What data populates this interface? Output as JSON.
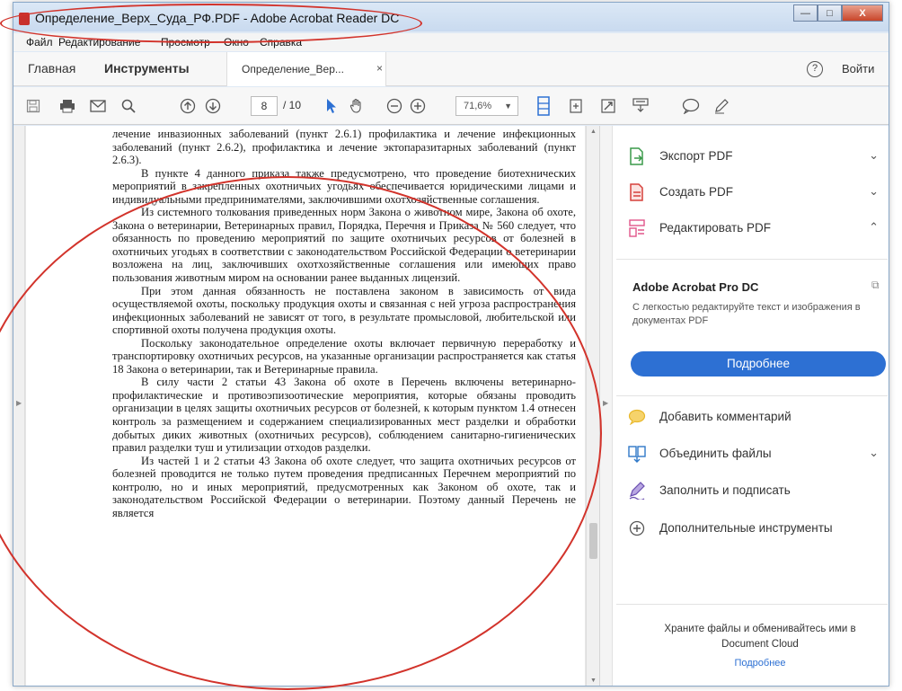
{
  "window": {
    "title": "Определение_Верх_Суда_РФ.PDF - Adobe Acrobat Reader DC",
    "min_btn": "—",
    "max_btn": "□",
    "close_btn": "X"
  },
  "menu": {
    "items": [
      "Файл",
      "Редактирование",
      "Просмотр",
      "Окно",
      "Справка"
    ]
  },
  "tabs": {
    "home": "Главная",
    "tools": "Инструменты",
    "doc": "Определение_Вер...",
    "doc_close": "×",
    "help": "?",
    "signin": "Войти"
  },
  "toolbar": {
    "page_current": "8",
    "page_total": "/ 10",
    "zoom": "71,6%"
  },
  "document": {
    "paragraphs": [
      "лечение инвазионных заболеваний (пункт 2.6.1) профилактика и лечение инфекционных заболеваний (пункт 2.6.2), профилактика и лечение эктопаразитарных заболеваний (пункт 2.6.3).",
      "В пункте 4 данного приказа также предусмотрено, что проведение биотехнических мероприятий в закрепленных охотничьих угодьях обеспечивается юридическими лицами и индивидуальными предпринимателями, заключившими охотхозяйственные соглашения.",
      "Из системного толкования приведенных норм Закона о животном мире, Закона об охоте, Закона о ветеринарии, Ветеринарных правил, Порядка, Перечня и Приказа № 560 следует, что обязанность по проведению мероприятий по защите охотничьих ресурсов от болезней в охотничьих угодьях в соответствии с законодательством Российской Федерации о ветеринарии возложена на лиц, заключивших охотхозяйственные соглашения или имеющих право пользования животным миром на основании ранее выданных лицензий.",
      "При этом данная обязанность не поставлена законом в зависимость от вида осуществляемой охоты, поскольку продукция охоты и связанная с ней угроза распространения инфекционных заболеваний не зависят от того, в результате промысловой, любительской или спортивной охоты получена продукция охоты.",
      "Поскольку законодательное определение охоты включает первичную переработку и транспортировку охотничьих ресурсов, на указанные организации распространяется как статья 18 Закона о ветеринарии, так и Ветеринарные правила.",
      "В силу части 2 статьи 43 Закона об охоте в Перечень включены ветеринарно-профилактические и противоэпизоотические мероприятия, которые обязаны проводить организации в целях защиты охотничьих ресурсов от болезней, к которым пунктом 1.4 отнесен контроль за размещением и содержанием специализированных мест разделки и обработки добытых диких животных (охотничьих ресурсов), соблюдением санитарно-гигиенических правил разделки туш и утилизации отходов разделки.",
      "Из частей 1 и 2 статьи 43 Закона об охоте следует, что защита охотничьих ресурсов от болезней проводится не только путем проведения предписанных Перечнем мероприятий по контролю, но и иных мероприятий, предусмотренных как Законом об охоте, так и законодательством Российской Федерации о ветеринарии. Поэтому данный Перечень не является"
    ]
  },
  "right_pane": {
    "export_pdf": "Экспорт PDF",
    "create_pdf": "Создать PDF",
    "edit_pdf": "Редактировать PDF",
    "pro_title": "Adobe Acrobat Pro DC",
    "pro_desc": "С легкостью редактируйте текст и изображения в документах PDF",
    "pro_button": "Подробнее",
    "add_comment": "Добавить комментарий",
    "combine_files": "Объединить файлы",
    "fill_sign": "Заполнить и подписать",
    "more_tools": "Дополнительные инструменты",
    "cloud_text": "Храните файлы и обменивайтесь ими в Document Cloud",
    "cloud_link": "Подробнее"
  },
  "colors": {
    "accent_blue": "#2d70d3",
    "annotation_red": "#d2332b",
    "export_green": "#3a9a4a",
    "create_red": "#d6403a",
    "edit_pink": "#e0568a",
    "comment_yellow": "#e8b82c",
    "combine_blue": "#2f78c8",
    "fill_purple": "#6a4fb0"
  },
  "icons": [
    "save-icon",
    "print-icon",
    "email-icon",
    "search-icon",
    "page-up-icon",
    "page-down-icon",
    "select-arrow-icon",
    "hand-icon",
    "zoom-out-icon",
    "zoom-in-icon",
    "fit-page-icon",
    "rotate-icon",
    "fullscreen-icon",
    "read-mode-icon",
    "comment-icon",
    "sign-pen-icon"
  ]
}
